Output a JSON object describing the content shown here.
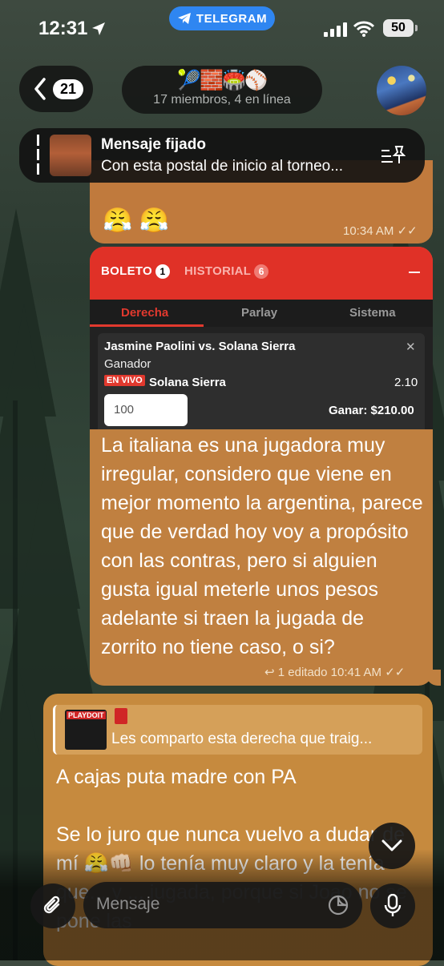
{
  "status_bar": {
    "time": "12:31",
    "battery": "50",
    "telegram_pill": "TELEGRAM"
  },
  "header": {
    "back_count": "21",
    "title_emojis": "🎾🧱🏟️⚾",
    "subtitle": "17 miembros, 4 en línea"
  },
  "pinned": {
    "title": "Mensaje fijado",
    "text": "Con esta postal de inicio al torneo..."
  },
  "messages": [
    {
      "reactions": "😤 😤",
      "time": "10:34 AM"
    },
    {
      "bet_slip": {
        "boleto_label": "BOLETO",
        "boleto_count": "1",
        "historial_label": "HISTORIAL",
        "historial_count": "6",
        "tabs": [
          "Derecha",
          "Parlay",
          "Sistema"
        ],
        "match": "Jasmine Paolini vs. Solana Sierra",
        "market": "Ganador",
        "live_badge": "EN VIVO",
        "selection": "Solana Sierra",
        "odds": "2.10",
        "stake": "100",
        "win": "Ganar: $210.00"
      },
      "text": "La italiana es una jugadora muy irregular, considero que viene en mejor momento la argentina, parece que de verdad hoy voy a propósito con las contras, pero si alguien gusta igual meterle unos pesos adelante si traen la jugada de zorrito no tiene caso, o si?",
      "meta": "1 editado 10:41 AM"
    },
    {
      "reply": {
        "brand": "PLAYDOIT",
        "text": "Les comparto esta derecha que traig..."
      },
      "text": "A cajas puta madre con PA\n\nSe lo juro que nunca vuelvo a dudar de mí 😤👊🏻 lo tenía  muy claro y la tenía que... y ... jugada, porque si Joao no se pone las"
    }
  ],
  "composer": {
    "placeholder": "Mensaje"
  },
  "colors": {
    "bubble": "#c08040",
    "bet_red": "#e03127",
    "telegram_blue": "#2f86f1"
  }
}
